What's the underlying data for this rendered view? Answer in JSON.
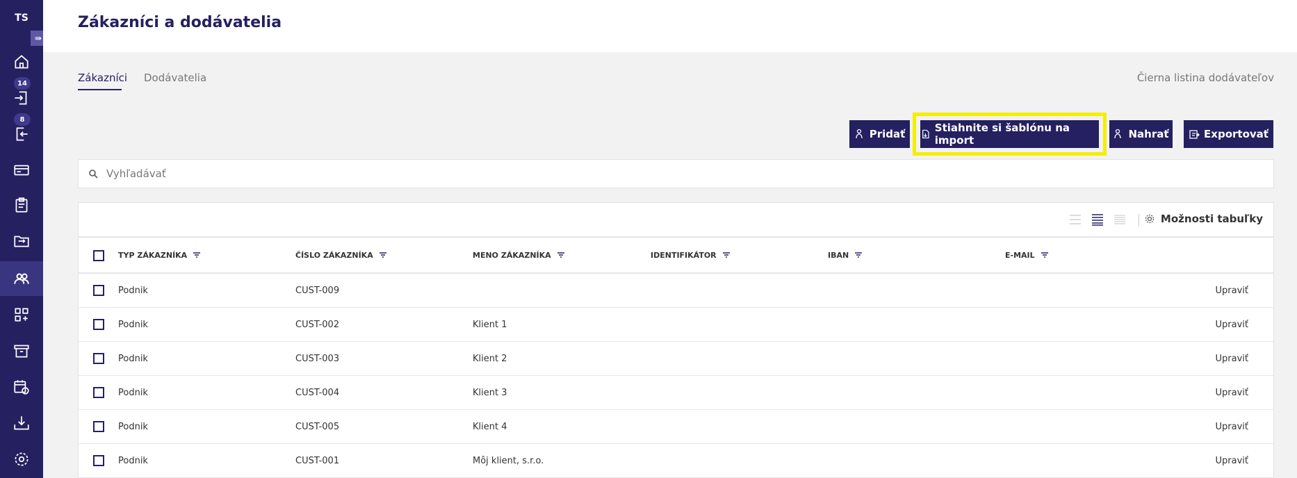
{
  "sidebar": {
    "logo": "TS",
    "collapse_icon": "expand-arrow-icon",
    "items": [
      {
        "icon": "home-icon"
      },
      {
        "icon": "inbox-in-icon",
        "badge": "14"
      },
      {
        "icon": "outbox-out-icon",
        "badge": "8"
      },
      {
        "icon": "credit-card-icon"
      },
      {
        "icon": "clipboard-icon"
      },
      {
        "icon": "folder-transfer-icon"
      },
      {
        "icon": "users-icon",
        "active": true
      },
      {
        "icon": "apps-add-icon"
      },
      {
        "icon": "archive-icon"
      },
      {
        "icon": "calendar-refresh-icon"
      },
      {
        "icon": "download-tray-icon"
      },
      {
        "icon": "settings-icon"
      }
    ]
  },
  "header": {
    "title": "Zákazníci a dodávatelia"
  },
  "tabs": [
    {
      "label": "Zákazníci",
      "active": true
    },
    {
      "label": "Dodávatelia",
      "active": false
    }
  ],
  "blacklist_label": "Čierna listina dodávateľov",
  "actions": {
    "add_label": "Pridať",
    "template_label": "Stiahnite si šablónu na import",
    "upload_label": "Nahrať",
    "export_label": "Exportovať"
  },
  "search": {
    "placeholder": "Vyhľadávať",
    "value": ""
  },
  "table": {
    "options_label": "Možnosti tabuľky",
    "columns": [
      "TYP ZÁKAZNÍKA",
      "ČÍSLO ZÁKAZNÍKA",
      "MENO ZÁKAZNÍKA",
      "IDENTIFIKÁTOR",
      "IBAN",
      "E-MAIL"
    ],
    "edit_label": "Upraviť",
    "rows": [
      {
        "type": "Podnik",
        "number": "CUST-009",
        "name": "",
        "identifier": "",
        "iban": "",
        "email": ""
      },
      {
        "type": "Podnik",
        "number": "CUST-002",
        "name": "Klient 1",
        "identifier": "",
        "iban": "",
        "email": ""
      },
      {
        "type": "Podnik",
        "number": "CUST-003",
        "name": "Klient 2",
        "identifier": "",
        "iban": "",
        "email": ""
      },
      {
        "type": "Podnik",
        "number": "CUST-004",
        "name": "Klient 3",
        "identifier": "",
        "iban": "",
        "email": ""
      },
      {
        "type": "Podnik",
        "number": "CUST-005",
        "name": "Klient 4",
        "identifier": "",
        "iban": "",
        "email": ""
      },
      {
        "type": "Podnik",
        "number": "CUST-001",
        "name": "Môj klient, s.r.o.",
        "identifier": "",
        "iban": "",
        "email": ""
      }
    ]
  },
  "colors": {
    "brand": "#252060",
    "highlight": "#f5ee00",
    "background": "#f2f2f2"
  }
}
